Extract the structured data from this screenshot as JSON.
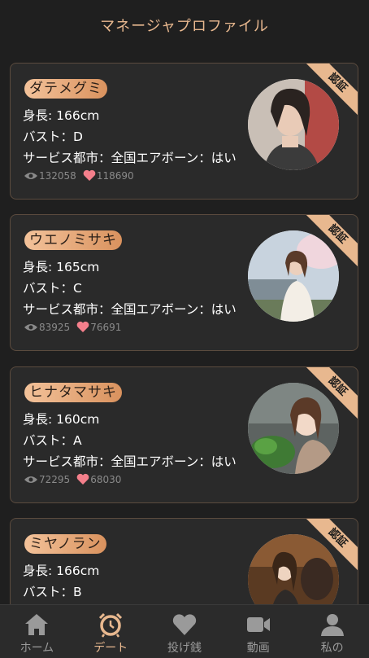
{
  "header": {
    "title": "マネージャプロファイル"
  },
  "card_labels": {
    "height_prefix": "身長: ",
    "bust_prefix": "バスト：",
    "service_text": "サービス都市：全国エアボーン：はい",
    "badge": "認証"
  },
  "profiles": [
    {
      "name": "ダテメグミ",
      "height": "166cm",
      "bust": "D",
      "views": "132058",
      "likes": "118690"
    },
    {
      "name": "ウエノミサキ",
      "height": "165cm",
      "bust": "C",
      "views": "83925",
      "likes": "76691"
    },
    {
      "name": "ヒナタマサキ",
      "height": "160cm",
      "bust": "A",
      "views": "72295",
      "likes": "68030"
    },
    {
      "name": "ミヤノラン",
      "height": "166cm",
      "bust": "B",
      "views": "",
      "likes": ""
    }
  ],
  "tabbar": {
    "items": [
      {
        "label": "ホーム",
        "icon": "home-icon"
      },
      {
        "label": "デート",
        "icon": "alarm-clock-icon"
      },
      {
        "label": "投げ銭",
        "icon": "heart-icon"
      },
      {
        "label": "動画",
        "icon": "video-icon"
      },
      {
        "label": "私の",
        "icon": "user-icon"
      }
    ],
    "active": 1
  },
  "colors": {
    "accent": "#e8b88f",
    "background": "#1f1f1f",
    "card": "#2a2a2a",
    "heart": "#f47f8b"
  }
}
